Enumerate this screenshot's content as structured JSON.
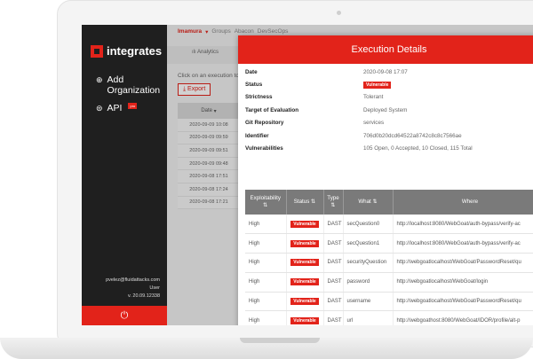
{
  "app": {
    "logo_text": "integrates",
    "brand_color": "#e2231a"
  },
  "sidebar": {
    "items": [
      {
        "label": "Add Organization",
        "icon": "plus-circle-icon"
      },
      {
        "label": "API",
        "icon": "user-circle-icon",
        "badge": "pro"
      }
    ],
    "user_email": "pvelez@fluidattacks.com",
    "user_role": "User",
    "version": "v. 20.09.12338",
    "power_icon": "power-icon"
  },
  "header": {
    "breadcrumb": [
      "Imamura",
      "Groups",
      "Abacon",
      "DevSecOps"
    ],
    "tab": "Analytics"
  },
  "main": {
    "hint": "Click on an execution to",
    "export_label": "Export",
    "date_header": "Date",
    "dates": [
      "2020-09-09 10:08",
      "2020-09-09 09:59",
      "2020-09-09 09:51",
      "2020-09-09 09:48",
      "2020-09-08 17:51",
      "2020-09-08 17:24",
      "2020-09-08 17:21"
    ]
  },
  "modal": {
    "title": "Execution Details",
    "details": [
      {
        "key": "Date",
        "value": "2020-09-08 17:07"
      },
      {
        "key": "Status",
        "value": "Vulnerable",
        "badge": true
      },
      {
        "key": "Strictness",
        "value": "Tolerant"
      },
      {
        "key": "Target of Evaluation",
        "value": "Deployed System"
      },
      {
        "key": "Git Repository",
        "value": "services"
      },
      {
        "key": "Identifier",
        "value": "706d0b20dcd64522a8742c8c8c7566ae"
      },
      {
        "key": "Vulnerabilities",
        "value": "105 Open, 0 Accepted, 10 Closed, 115 Total"
      }
    ],
    "table": {
      "headers": [
        "Exploitability",
        "Status",
        "Type",
        "What",
        "Where"
      ],
      "rows": [
        {
          "exploitability": "High",
          "status": "Vulnerable",
          "type": "DAST",
          "what": "secQuestion0",
          "where": "http://localhost:8080/WebGoat/auth-bypass/verify-ac"
        },
        {
          "exploitability": "High",
          "status": "Vulnerable",
          "type": "DAST",
          "what": "secQuestion1",
          "where": "http://localhost:8080/WebGoat/auth-bypass/verify-ac"
        },
        {
          "exploitability": "High",
          "status": "Vulnerable",
          "type": "DAST",
          "what": "securityQuestion",
          "where": "http://webgoatlocalhost/WebGoat/PasswordReset/qu"
        },
        {
          "exploitability": "High",
          "status": "Vulnerable",
          "type": "DAST",
          "what": "password",
          "where": "http://webgoatlocalhost/WebGoat/login"
        },
        {
          "exploitability": "High",
          "status": "Vulnerable",
          "type": "DAST",
          "what": "username",
          "where": "http://webgoatlocalhost/WebGoat/PasswordReset/qu"
        },
        {
          "exploitability": "High",
          "status": "Vulnerable",
          "type": "DAST",
          "what": "url",
          "where": "http://webgoathost:8080/WebGoat/IDOR/profile/alt-p"
        },
        {
          "exploitability": "High",
          "status": "Vulnerable",
          "type": "DAST",
          "what": "userid",
          "where": "http://webgoathost:8080/WebGoat/IDOR/profile/{use"
        }
      ]
    }
  }
}
